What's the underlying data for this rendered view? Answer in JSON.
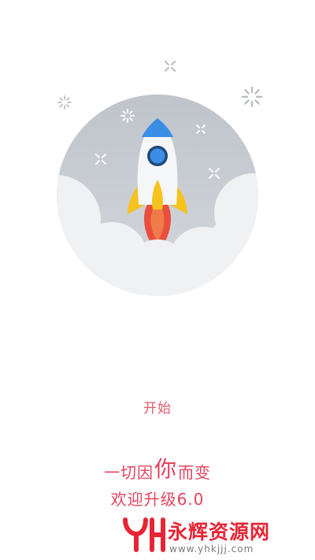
{
  "splash": {
    "start_label": "开始",
    "slogan_part1": "一切因",
    "slogan_emphasis": "你",
    "slogan_part2": "而变",
    "version_text": "欢迎升级6.0"
  },
  "watermark": {
    "logo_text": "YH",
    "name": "永辉资源网",
    "url": "www.yhkjjj.com"
  },
  "icons": {
    "illustration": "rocket-launch-icon",
    "decor": "sparkle-icon"
  },
  "colors": {
    "accent": "#e5435d",
    "circle": "#c8ccd2",
    "cloud": "#f0f1f3",
    "rocket_body": "#f5f6f8",
    "rocket_window": "#3a8ee6",
    "rocket_fin": "#f6c21c",
    "rocket_flame": "#ea4e3d",
    "watermark_red": "#e62535"
  }
}
